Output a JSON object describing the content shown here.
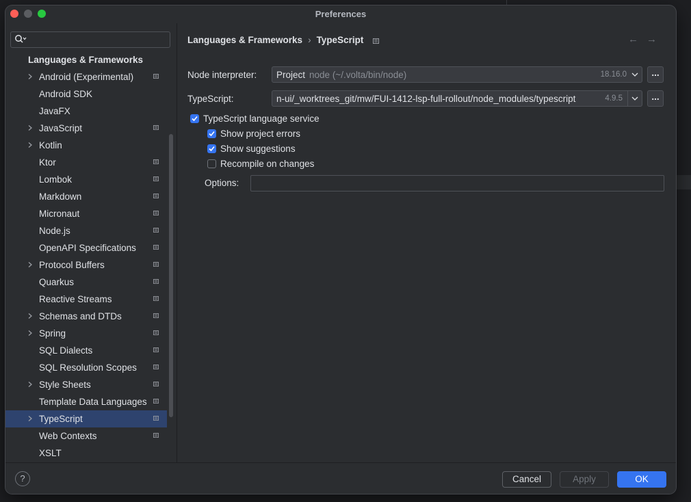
{
  "window": {
    "title": "Preferences"
  },
  "search": {
    "placeholder": "",
    "value": ""
  },
  "sidebar": {
    "section_title": "Languages & Frameworks",
    "items": [
      {
        "label": "Android (Experimental)",
        "expandable": true,
        "project_icon": true
      },
      {
        "label": "Android SDK",
        "expandable": false,
        "project_icon": false
      },
      {
        "label": "JavaFX",
        "expandable": false,
        "project_icon": false
      },
      {
        "label": "JavaScript",
        "expandable": true,
        "project_icon": true
      },
      {
        "label": "Kotlin",
        "expandable": true,
        "project_icon": false
      },
      {
        "label": "Ktor",
        "expandable": false,
        "project_icon": true
      },
      {
        "label": "Lombok",
        "expandable": false,
        "project_icon": true
      },
      {
        "label": "Markdown",
        "expandable": false,
        "project_icon": true
      },
      {
        "label": "Micronaut",
        "expandable": false,
        "project_icon": true
      },
      {
        "label": "Node.js",
        "expandable": false,
        "project_icon": true
      },
      {
        "label": "OpenAPI Specifications",
        "expandable": false,
        "project_icon": true
      },
      {
        "label": "Protocol Buffers",
        "expandable": true,
        "project_icon": true
      },
      {
        "label": "Quarkus",
        "expandable": false,
        "project_icon": true
      },
      {
        "label": "Reactive Streams",
        "expandable": false,
        "project_icon": true
      },
      {
        "label": "Schemas and DTDs",
        "expandable": true,
        "project_icon": true
      },
      {
        "label": "Spring",
        "expandable": true,
        "project_icon": true
      },
      {
        "label": "SQL Dialects",
        "expandable": false,
        "project_icon": true
      },
      {
        "label": "SQL Resolution Scopes",
        "expandable": false,
        "project_icon": true
      },
      {
        "label": "Style Sheets",
        "expandable": true,
        "project_icon": true
      },
      {
        "label": "Template Data Languages",
        "expandable": false,
        "project_icon": true
      },
      {
        "label": "TypeScript",
        "expandable": true,
        "project_icon": true,
        "selected": true
      },
      {
        "label": "Web Contexts",
        "expandable": false,
        "project_icon": true
      },
      {
        "label": "XSLT",
        "expandable": false,
        "project_icon": false
      }
    ]
  },
  "breadcrumb": {
    "parent": "Languages & Frameworks",
    "separator": "›",
    "current": "TypeScript"
  },
  "nav": {
    "back": "←",
    "forward": "→"
  },
  "node_interpreter": {
    "label": "Node interpreter:",
    "value_bold": "Project",
    "value_path": "node (~/.volta/bin/node)",
    "version": "18.16.0",
    "browse": "..."
  },
  "typescript": {
    "label": "TypeScript:",
    "value": "n-ui/_worktrees_git/mw/FUI-1412-lsp-full-rollout/node_modules/typescript",
    "version": "4.9.5",
    "browse": "..."
  },
  "service": {
    "language_service": {
      "label": "TypeScript language service",
      "checked": true
    },
    "show_errors": {
      "label": "Show project errors",
      "checked": true
    },
    "show_suggestions": {
      "label": "Show suggestions",
      "checked": true
    },
    "recompile": {
      "label": "Recompile on changes",
      "checked": false
    }
  },
  "options": {
    "label": "Options:",
    "value": ""
  },
  "footer": {
    "help": "?",
    "cancel": "Cancel",
    "apply": "Apply",
    "ok": "OK"
  },
  "colors": {
    "accent": "#3574f0",
    "selection": "#2e436e",
    "panel": "#2b2d30"
  }
}
